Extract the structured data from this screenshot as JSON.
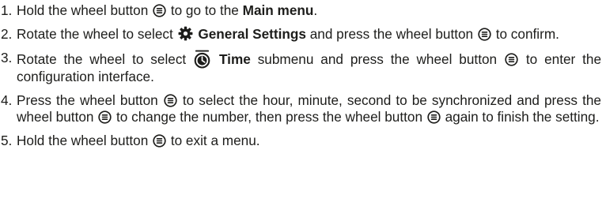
{
  "steps": [
    {
      "number": "1.",
      "parts": {
        "a": "Hold the wheel button",
        "b": "to go to the",
        "c": "Main menu",
        "d": "."
      }
    },
    {
      "number": "2.",
      "parts": {
        "a": "Rotate the wheel to select",
        "b": "General Settings",
        "c": "and press the wheel button",
        "d": "to confirm."
      }
    },
    {
      "number": "3.",
      "parts": {
        "a": "Rotate the wheel to select",
        "b": "Time",
        "c": "submenu and press the wheel button",
        "d": "to enter the configuration interface."
      }
    },
    {
      "number": "4.",
      "parts": {
        "a": "Press the wheel button",
        "b": "to select the hour, minute, second to be synchronized and press the wheel button",
        "c": "to change the number, then press the wheel button",
        "d": "again to finish the setting."
      }
    },
    {
      "number": "5.",
      "parts": {
        "a": "Hold the wheel button",
        "b": "to exit a menu."
      }
    }
  ],
  "icons": {
    "wheel_button": "wheel-button-icon",
    "general_settings": "gear-icon",
    "time": "clock-icon"
  },
  "colors": {
    "text": "#1d1d1b",
    "background": "#ffffff"
  }
}
